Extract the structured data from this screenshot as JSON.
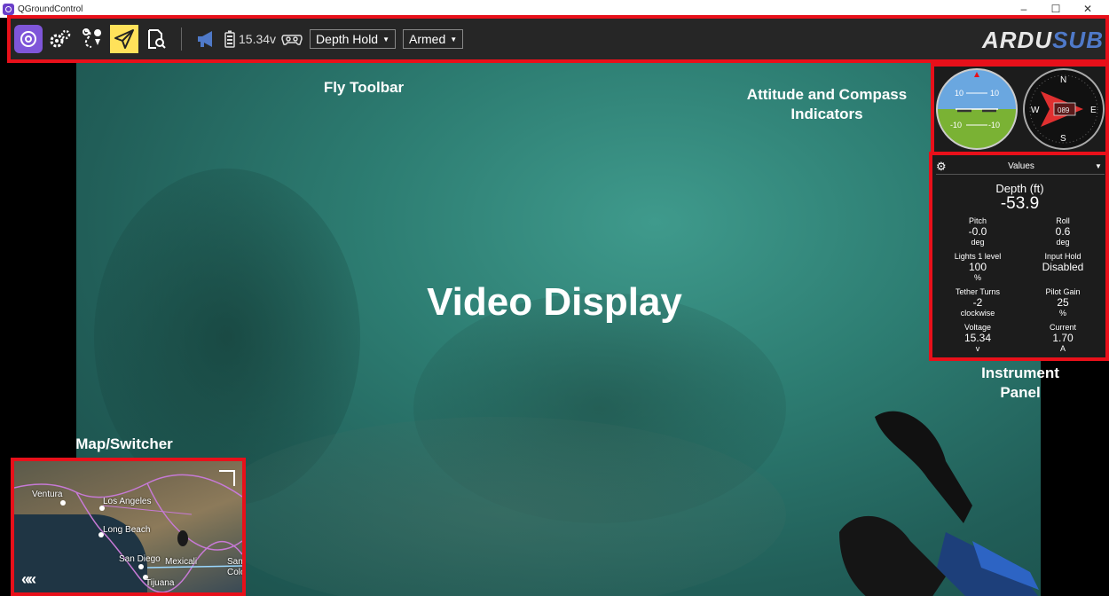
{
  "window": {
    "title": "QGroundControl",
    "controls": [
      "–",
      "☐",
      "✕"
    ]
  },
  "toolbar": {
    "icons": [
      "qgc-home-icon",
      "vehicle-setup-gear-icon",
      "plan-route-icon",
      "fly-paper-plane-icon",
      "analyze-document-icon"
    ],
    "messages_icon": "megaphone-icon",
    "battery_icon": "battery-icon",
    "voltage": "15.34v",
    "joystick_icon": "gamepad-icon",
    "flight_mode": "Depth Hold",
    "arm_state": "Armed",
    "brand_a": "ARDU",
    "brand_b": "SUB"
  },
  "annotations": {
    "fly_toolbar": "Fly Toolbar",
    "attitude_compass_line1": "Attitude and Compass",
    "attitude_compass_line2": "Indicators",
    "video_display": "Video Display",
    "instrument_panel_line1": "Instrument",
    "instrument_panel_line2": "Panel",
    "map_switcher": "Map/Switcher"
  },
  "attitude": {
    "pitch_marks": [
      "10",
      "10",
      "-10",
      "-10"
    ]
  },
  "compass": {
    "north": "N",
    "south": "S",
    "east": "E",
    "west": "W",
    "heading": "089"
  },
  "instrument_panel": {
    "header": "Values",
    "depth_label": "Depth (ft)",
    "depth_value": "-53.9",
    "cells": [
      {
        "label": "Pitch",
        "value": "-0.0",
        "unit": "deg"
      },
      {
        "label": "Roll",
        "value": "0.6",
        "unit": "deg"
      },
      {
        "label": "Lights 1 level",
        "value": "100",
        "unit": "%"
      },
      {
        "label": "Input Hold",
        "value": "Disabled",
        "unit": ""
      },
      {
        "label": "Tether Turns",
        "value": "-2",
        "unit": "clockwise"
      },
      {
        "label": "Pilot Gain",
        "value": "25",
        "unit": "%"
      },
      {
        "label": "Voltage",
        "value": "15.34",
        "unit": "v"
      },
      {
        "label": "Current",
        "value": "1.70",
        "unit": "A"
      }
    ]
  },
  "map": {
    "places": [
      "Ventura",
      "Los Angeles",
      "Long Beach",
      "San Diego",
      "Mexicali",
      "Tijuana",
      "San",
      "Colo"
    ],
    "back_glyph": "««"
  },
  "colors": {
    "highlight": "#e8101a",
    "active_tool": "#ffe25a",
    "brand_purple": "#7f56d9",
    "brand_blue": "#4f79c8"
  }
}
